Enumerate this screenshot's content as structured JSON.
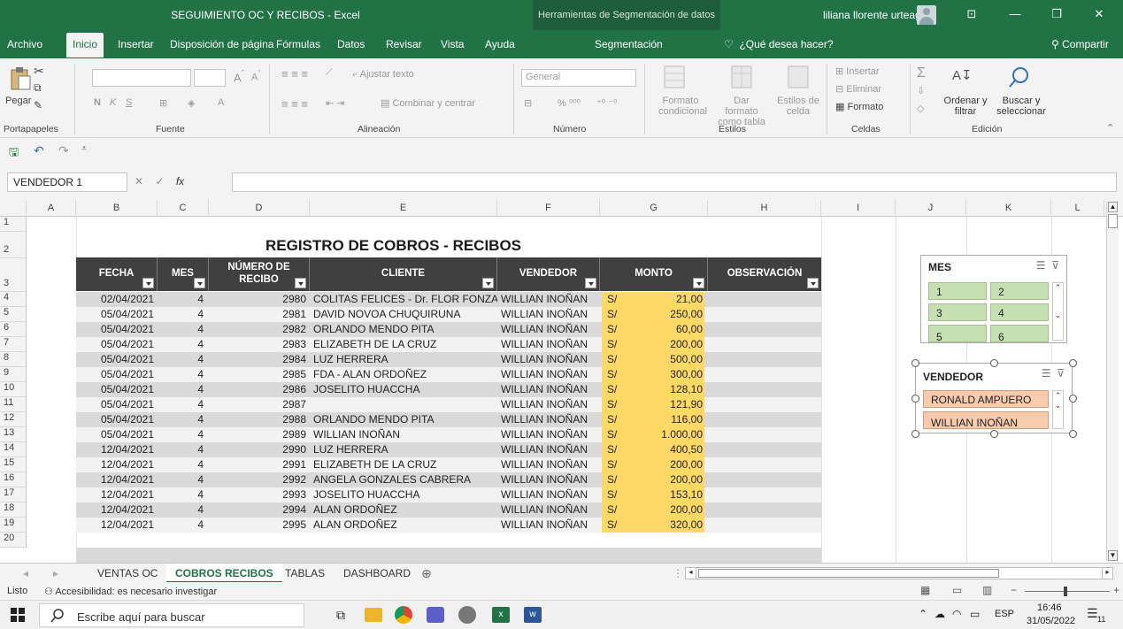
{
  "titlebar": {
    "title": "SEGUIMIENTO OC Y RECIBOS  -  Excel",
    "context_tab": "Herramientas de Segmentación de datos",
    "user": "liliana llorente urteaga"
  },
  "menu": {
    "tabs": [
      "Archivo",
      "Inicio",
      "Insertar",
      "Disposición de página",
      "Fórmulas",
      "Datos",
      "Revisar",
      "Vista",
      "Ayuda",
      "Segmentación"
    ],
    "active": "Inicio",
    "tell_me": "¿Qué desea hacer?",
    "share": "Compartir"
  },
  "ribbon": {
    "paste": "Pegar",
    "clipboard": "Portapapeles",
    "font": "Fuente",
    "alignment": "Alineación",
    "wrap": "Ajustar texto",
    "merge": "Combinar y centrar",
    "number_format": "General",
    "number": "Número",
    "cond_format_1": "Formato",
    "cond_format_2": "condicional",
    "format_table_1": "Dar formato",
    "format_table_2": "como tabla",
    "cell_styles_1": "Estilos de",
    "cell_styles_2": "celda",
    "styles": "Estilos",
    "insert": "Insertar",
    "delete": "Eliminar",
    "format": "Formato",
    "cells": "Celdas",
    "sort_1": "Ordenar y",
    "sort_2": "filtrar",
    "find_1": "Buscar y",
    "find_2": "seleccionar",
    "editing": "Edición",
    "bold": "N",
    "italic": "K",
    "underline": "S"
  },
  "formula_bar": {
    "name_box": "VENDEDOR 1",
    "fx": "fx",
    "value": ""
  },
  "columns": [
    "A",
    "B",
    "C",
    "D",
    "E",
    "F",
    "G",
    "H",
    "I",
    "J",
    "K",
    "L"
  ],
  "row_numbers": [
    "1",
    "2",
    "3",
    "4",
    "5",
    "6",
    "7",
    "8",
    "9",
    "10",
    "11",
    "12",
    "13",
    "14",
    "15",
    "16",
    "17",
    "18",
    "19",
    "20"
  ],
  "sheet": {
    "title": "REGISTRO DE COBROS  - RECIBOS",
    "headers": {
      "fecha": "FECHA",
      "mes": "MES",
      "recibo_1": "NÚMERO DE",
      "recibo_2": "RECIBO",
      "cliente": "CLIENTE",
      "vendedor": "VENDEDOR",
      "monto": "MONTO",
      "observacion": "OBSERVACIÓN"
    },
    "currency": "S/",
    "rows": [
      {
        "fecha": "02/04/2021",
        "mes": "4",
        "recibo": "2980",
        "cliente": "COLITAS FELICES - Dr. FLOR FONZALES",
        "vendedor": "WILLIAN INOÑAN",
        "monto": "21,00"
      },
      {
        "fecha": "05/04/2021",
        "mes": "4",
        "recibo": "2981",
        "cliente": "DAVID NOVOA CHUQUIRUNA",
        "vendedor": "WILLIAN INOÑAN",
        "monto": "250,00"
      },
      {
        "fecha": "05/04/2021",
        "mes": "4",
        "recibo": "2982",
        "cliente": "ORLANDO MENDO PITA",
        "vendedor": "WILLIAN INOÑAN",
        "monto": "60,00"
      },
      {
        "fecha": "05/04/2021",
        "mes": "4",
        "recibo": "2983",
        "cliente": "ELIZABETH DE LA CRUZ",
        "vendedor": "WILLIAN INOÑAN",
        "monto": "200,00"
      },
      {
        "fecha": "05/04/2021",
        "mes": "4",
        "recibo": "2984",
        "cliente": "LUZ HERRERA",
        "vendedor": "WILLIAN INOÑAN",
        "monto": "500,00"
      },
      {
        "fecha": "05/04/2021",
        "mes": "4",
        "recibo": "2985",
        "cliente": "FDA - ALAN ORDOÑEZ",
        "vendedor": "WILLIAN INOÑAN",
        "monto": "300,00"
      },
      {
        "fecha": "05/04/2021",
        "mes": "4",
        "recibo": "2986",
        "cliente": "JOSELITO HUACCHA",
        "vendedor": "WILLIAN INOÑAN",
        "monto": "128,10"
      },
      {
        "fecha": "05/04/2021",
        "mes": "4",
        "recibo": "2987",
        "cliente": "",
        "vendedor": "WILLIAN INOÑAN",
        "monto": "121,90"
      },
      {
        "fecha": "05/04/2021",
        "mes": "4",
        "recibo": "2988",
        "cliente": "ORLANDO MENDO PITA",
        "vendedor": "WILLIAN INOÑAN",
        "monto": "116,00"
      },
      {
        "fecha": "05/04/2021",
        "mes": "4",
        "recibo": "2989",
        "cliente": "WILLIAN INOÑAN",
        "vendedor": "WILLIAN INOÑAN",
        "monto": "1.000,00"
      },
      {
        "fecha": "12/04/2021",
        "mes": "4",
        "recibo": "2990",
        "cliente": "LUZ HERRERA",
        "vendedor": "WILLIAN INOÑAN",
        "monto": "400,50"
      },
      {
        "fecha": "12/04/2021",
        "mes": "4",
        "recibo": "2991",
        "cliente": "ELIZABETH DE LA CRUZ",
        "vendedor": "WILLIAN INOÑAN",
        "monto": "200,00"
      },
      {
        "fecha": "12/04/2021",
        "mes": "4",
        "recibo": "2992",
        "cliente": "ANGELA GONZALES CABRERA",
        "vendedor": "WILLIAN INOÑAN",
        "monto": "200,00"
      },
      {
        "fecha": "12/04/2021",
        "mes": "4",
        "recibo": "2993",
        "cliente": "JOSELITO HUACCHA",
        "vendedor": "WILLIAN INOÑAN",
        "monto": "153,10"
      },
      {
        "fecha": "12/04/2021",
        "mes": "4",
        "recibo": "2994",
        "cliente": "ALAN ORDOÑEZ",
        "vendedor": "WILLIAN INOÑAN",
        "monto": "200,00"
      },
      {
        "fecha": "12/04/2021",
        "mes": "4",
        "recibo": "2995",
        "cliente": "ALAN ORDOÑEZ",
        "vendedor": "WILLIAN INOÑAN",
        "monto": "320,00"
      }
    ]
  },
  "slicer_mes": {
    "title": "MES",
    "items": [
      "1",
      "2",
      "3",
      "4",
      "5",
      "6"
    ]
  },
  "slicer_vendedor": {
    "title": "VENDEDOR",
    "items": [
      "RONALD AMPUERO",
      "WILLIAN INOÑAN"
    ]
  },
  "sheet_tabs": {
    "tabs": [
      "VENTAS OC",
      "COBROS RECIBOS",
      "TABLAS",
      "DASHBOARD"
    ],
    "active": "COBROS RECIBOS"
  },
  "status": {
    "ready": "Listo",
    "accessibility": "Accesibilidad: es necesario investigar"
  },
  "taskbar": {
    "search_placeholder": "Escribe aquí para buscar",
    "language": "ESP",
    "time": "16:46",
    "date": "31/05/2022",
    "notifications": "11"
  },
  "colors": {
    "excel_green": "#217346",
    "header_dark": "#404040",
    "monto_yellow": "#ffd966",
    "slicer_green": "#c6e0b4",
    "slicer_orange": "#f8cbad"
  }
}
